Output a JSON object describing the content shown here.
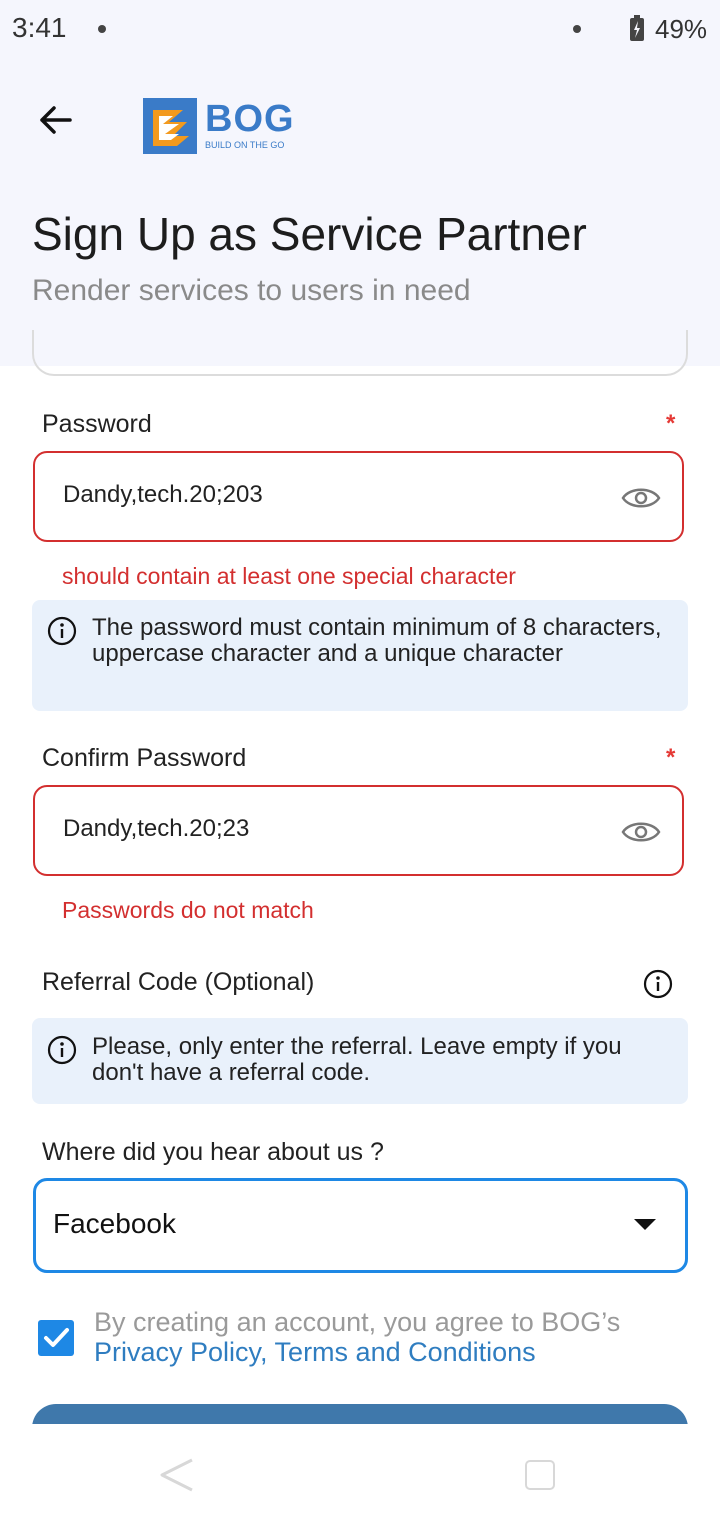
{
  "status_bar": {
    "time": "3:41",
    "battery": "49%"
  },
  "header": {
    "logo_text": "BOG",
    "logo_tagline": "BUILD ON THE GO",
    "title": "Sign Up as Service Partner",
    "subtitle": "Render services to users in need"
  },
  "password": {
    "label": "Password",
    "required_mark": "*",
    "value": "Dandy,tech.20;203",
    "error": "should contain at least one special character",
    "hint": "The password must contain minimum of 8 characters, uppercase character and a unique character"
  },
  "confirm_password": {
    "label": "Confirm Password",
    "required_mark": "*",
    "value": "Dandy,tech.20;23",
    "error": "Passwords do not match"
  },
  "referral": {
    "label": "Referral Code (Optional)",
    "hint": "Please, only enter the referral. Leave empty if you don't have a referral code."
  },
  "source": {
    "label": "Where did you hear about us ?",
    "selected": "Facebook"
  },
  "agreement": {
    "checked": true,
    "text": "By creating an account, you agree to BOG’s",
    "links": "Privacy Policy, Terms and Conditions"
  },
  "colors": {
    "brand_blue": "#3a7bc8",
    "brand_orange": "#f39a1e",
    "error_red": "#d32f2f",
    "accent_blue": "#1e88e5",
    "header_bg": "#f5f6fd"
  }
}
